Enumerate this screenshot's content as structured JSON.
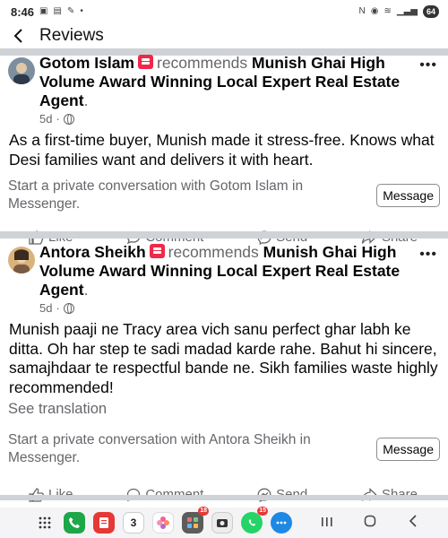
{
  "status_bar": {
    "time": "8:46",
    "battery": "64"
  },
  "header": {
    "title": "Reviews"
  },
  "reviews": [
    {
      "author": "Gotom Islam",
      "verb": "recommends",
      "target": "Munish Ghai High Volume Award Winning Local Expert Real Estate Agent",
      "period": ".",
      "time": "5d",
      "body": "As a first-time buyer, Munish made it stress-free. Knows what Desi families want and delivers it with heart.",
      "messenger_prompt": "Start a private conversation with Gotom Islam in Messenger.",
      "message_label": "Message"
    },
    {
      "author": "Antora Sheikh",
      "verb": "recommends",
      "target": "Munish Ghai High Volume Award Winning Local Expert Real Estate Agent",
      "period": ".",
      "time": "5d",
      "body": "Munish paaji ne Tracy area vich sanu perfect ghar labh ke ditta. Oh har step te sadi madad karde rahe. Bahut hi sincere, samajhdaar te respectful bande ne. Sikh families waste highly recommended!",
      "see_translation": "See translation",
      "messenger_prompt": "Start a private conversation with Antora Sheikh in Messenger.",
      "message_label": "Message"
    }
  ],
  "actions": {
    "like": "Like",
    "comment": "Comment",
    "send": "Send",
    "share": "Share"
  },
  "dock": {
    "calendar_day": "3",
    "badges": {
      "app_folder": "18",
      "whatsapp": "15"
    }
  },
  "colors": {
    "accent_red": "#f02849",
    "meta_gray": "#65676b",
    "separator": "#cfd2d6"
  }
}
